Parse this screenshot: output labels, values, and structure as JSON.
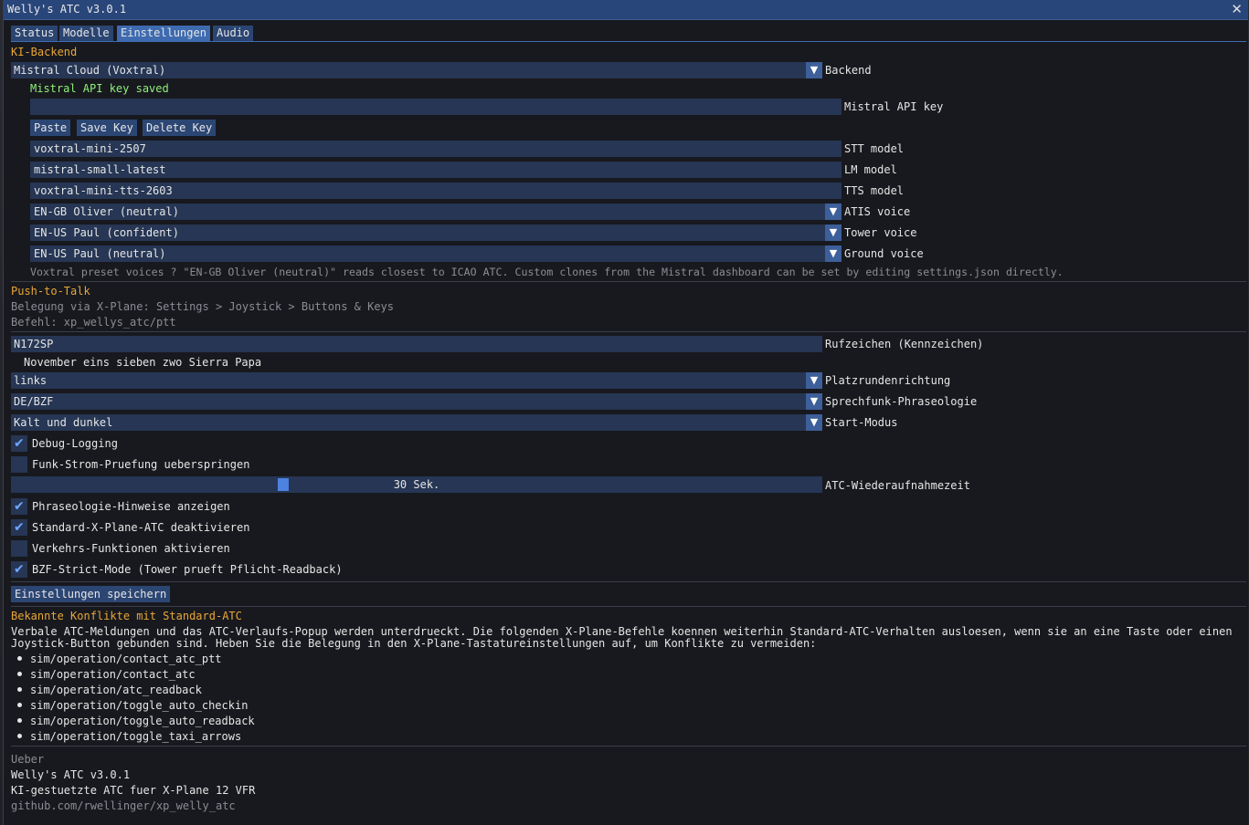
{
  "window": {
    "title": "Welly's ATC v3.0.1",
    "close": "✕"
  },
  "tabs": [
    "Status",
    "Modelle",
    "Einstellungen",
    "Audio"
  ],
  "ki_backend": {
    "heading": "KI-Backend",
    "backend": {
      "value": "Mistral Cloud (Voxtral)",
      "label": "Backend"
    },
    "status": "Mistral API key saved",
    "api_key": {
      "value": "",
      "label": "Mistral API key"
    },
    "buttons": {
      "paste": "Paste",
      "save": "Save Key",
      "delete": "Delete Key"
    },
    "stt": {
      "value": "voxtral-mini-2507",
      "label": "STT model"
    },
    "lm": {
      "value": "mistral-small-latest",
      "label": "LM model"
    },
    "tts": {
      "value": "voxtral-mini-tts-2603",
      "label": "TTS model"
    },
    "atis_voice": {
      "value": "EN-GB Oliver (neutral)",
      "label": "ATIS voice"
    },
    "tower_voice": {
      "value": "EN-US Paul (confident)",
      "label": "Tower voice"
    },
    "ground_voice": {
      "value": "EN-US Paul (neutral)",
      "label": "Ground voice"
    },
    "hint": "Voxtral preset voices ? \"EN-GB Oliver (neutral)\" reads closest to ICAO ATC. Custom clones from the Mistral dashboard can be set by editing settings.json directly."
  },
  "ptt": {
    "heading": "Push-to-Talk",
    "line1": "Belegung via X-Plane: Settings > Joystick > Buttons & Keys",
    "line2": "Befehl: xp_wellys_atc/ptt"
  },
  "general": {
    "callsign": {
      "value": "N172SP",
      "label": "Rufzeichen (Kennzeichen)"
    },
    "callsign_phonetic": "November eins sieben zwo Sierra Papa",
    "pattern": {
      "value": "links",
      "label": "Platzrundenrichtung"
    },
    "phraseology": {
      "value": "DE/BZF",
      "label": "Sprechfunk-Phraseologie"
    },
    "start_mode": {
      "value": "Kalt und dunkel",
      "label": "Start-Modus"
    },
    "debug_logging": {
      "label": "Debug-Logging",
      "checked": true
    },
    "skip_radio_power": {
      "label": "Funk-Strom-Pruefung ueberspringen",
      "checked": false
    },
    "resume_time": {
      "value": "30 Sek.",
      "label": "ATC-Wiederaufnahmezeit",
      "fraction": 0.33
    },
    "phraseology_hints": {
      "label": "Phraseologie-Hinweise anzeigen",
      "checked": true
    },
    "disable_default_atc": {
      "label": "Standard-X-Plane-ATC deaktivieren",
      "checked": true
    },
    "traffic_functions": {
      "label": "Verkehrs-Funktionen aktivieren",
      "checked": false
    },
    "bzf_strict": {
      "label": "BZF-Strict-Mode (Tower prueft Pflicht-Readback)",
      "checked": true
    },
    "save_button": "Einstellungen speichern"
  },
  "conflicts": {
    "heading": "Bekannte Konflikte mit Standard-ATC",
    "text1": "Verbale ATC-Meldungen und das ATC-Verlaufs-Popup werden unterdrueckt. Die folgenden X-Plane-Befehle koennen weiterhin Standard-ATC-Verhalten ausloesen, wenn sie an eine Taste oder einen",
    "text2": "Joystick-Button gebunden sind. Heben Sie die Belegung in den X-Plane-Tastatureinstellungen auf, um Konflikte zu vermeiden:",
    "commands": [
      "sim/operation/contact_atc_ptt",
      "sim/operation/contact_atc",
      "sim/operation/atc_readback",
      "sim/operation/toggle_auto_checkin",
      "sim/operation/toggle_auto_readback",
      "sim/operation/toggle_taxi_arrows"
    ]
  },
  "about": {
    "heading": "Ueber",
    "version": "Welly's ATC v3.0.1",
    "description": "KI-gestuetzte ATC fuer X-Plane 12 VFR",
    "link": "github.com/rwellinger/xp_welly_atc"
  }
}
